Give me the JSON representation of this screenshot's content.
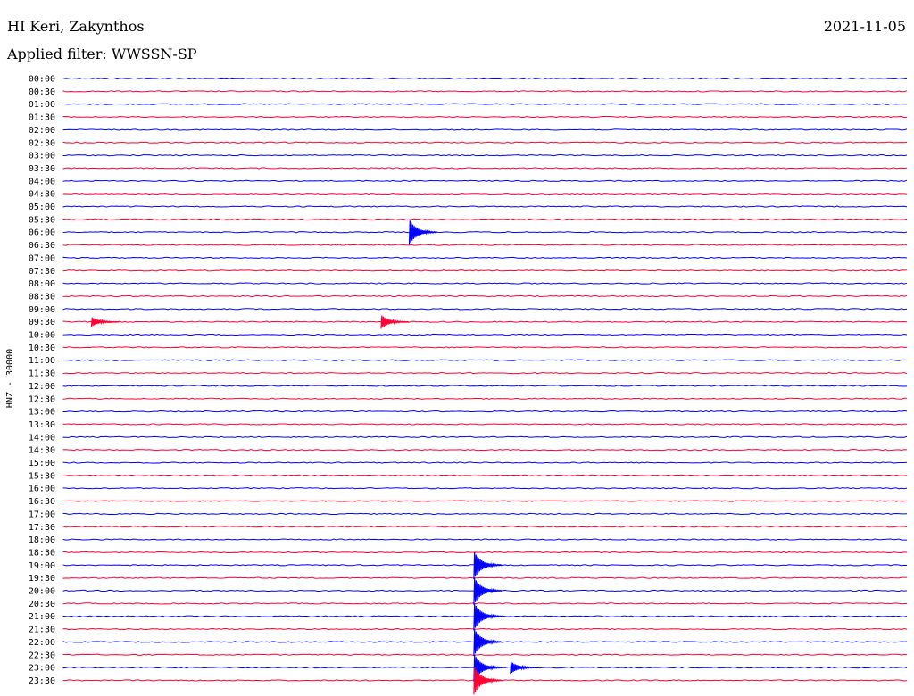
{
  "header": {
    "station": "HI Keri, Zakynthos",
    "filter": "Applied filter: WWSSN-SP",
    "date": "2021-11-05"
  },
  "chart_data": {
    "type": "line",
    "title": "HI Keri, Zakynthos",
    "subtitle": "Applied filter: WWSSN-SP",
    "date": "2021-11-05",
    "ylabel": "HNZ - 30000",
    "xlabel": "",
    "colors": {
      "odd_rows": "#0000ff",
      "even_rows": "#ff0033"
    },
    "rows": [
      "00:00",
      "00:30",
      "01:00",
      "01:30",
      "02:00",
      "02:30",
      "03:00",
      "03:30",
      "04:00",
      "04:30",
      "05:00",
      "05:30",
      "06:00",
      "06:30",
      "07:00",
      "07:30",
      "08:00",
      "08:30",
      "09:00",
      "09:30",
      "10:00",
      "10:30",
      "11:00",
      "11:30",
      "12:00",
      "12:30",
      "13:00",
      "13:30",
      "14:00",
      "14:30",
      "15:00",
      "15:30",
      "16:00",
      "16:30",
      "17:00",
      "17:30",
      "18:00",
      "18:30",
      "19:00",
      "19:30",
      "20:00",
      "20:30",
      "21:00",
      "21:30",
      "22:00",
      "22:30",
      "23:00",
      "23:30"
    ],
    "events": [
      {
        "row": "06:00",
        "minute": 12.3,
        "amplitude": 0.9
      },
      {
        "row": "09:30",
        "minute": 1.0,
        "amplitude": 0.35
      },
      {
        "row": "09:30",
        "minute": 11.3,
        "amplitude": 0.5
      },
      {
        "row": "19:00",
        "minute": 14.6,
        "amplitude": 1.0
      },
      {
        "row": "20:00",
        "minute": 14.6,
        "amplitude": 1.0
      },
      {
        "row": "21:00",
        "minute": 14.6,
        "amplitude": 1.0
      },
      {
        "row": "22:00",
        "minute": 14.6,
        "amplitude": 1.0
      },
      {
        "row": "23:00",
        "minute": 14.6,
        "amplitude": 1.0
      },
      {
        "row": "23:00",
        "minute": 15.9,
        "amplitude": 0.45
      },
      {
        "row": "23:30",
        "minute": 14.6,
        "amplitude": 1.0
      }
    ]
  }
}
